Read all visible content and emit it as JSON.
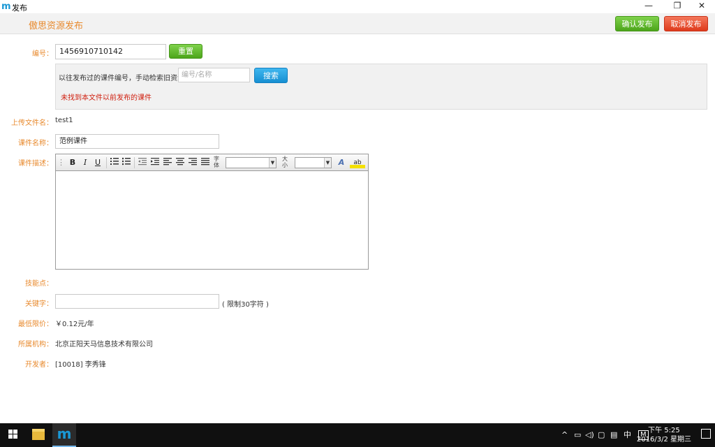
{
  "window": {
    "logo": "m",
    "title": "发布",
    "minimize": "—",
    "restore": "❐",
    "close": "✕"
  },
  "header": {
    "title": "傲思资源发布",
    "confirm_label": "确认发布",
    "cancel_label": "取消发布"
  },
  "form": {
    "number_label": "编号：",
    "number_value": "1456910710142",
    "reset_label": "重置",
    "search_prompt": "以往发布过的课件编号，手动检索旧资源：",
    "search_placeholder": "编号/名称",
    "search_label": "搜索",
    "not_found": "未找到本文件以前发布的课件",
    "filename_label": "上传文件名：",
    "filename_value": "test1",
    "course_name_label": "课件名称：",
    "course_name_value": "范例课件",
    "description_label": "课件描述：",
    "skills_label": "技能点：",
    "keywords_label": "关键字：",
    "keywords_limit": "( 限制30字符 )",
    "min_price_label": "最低限价：",
    "min_price_value": "￥0.12元/年",
    "org_label": "所属机构：",
    "org_value": "北京正阳天马信息技术有限公司",
    "developer_label": "开发者：",
    "developer_value": "[10018] 李秀锋"
  },
  "editor_toolbar": {
    "bold": "B",
    "italic": "I",
    "underline": "U",
    "font_label": "字体",
    "size_label": "大小",
    "font_color": "A",
    "highlight": "ab"
  },
  "taskbar": {
    "app_m": "m",
    "tray_ime": "中",
    "tray_m": "M",
    "clock_time": "下午 5:25",
    "clock_date": "2016/3/2 星期三"
  },
  "colors": {
    "accent_orange": "#e88a2e",
    "confirm_green": "#4ca51a",
    "cancel_red": "#de3a1c",
    "search_blue": "#168fd2",
    "error_red": "#d02010"
  }
}
